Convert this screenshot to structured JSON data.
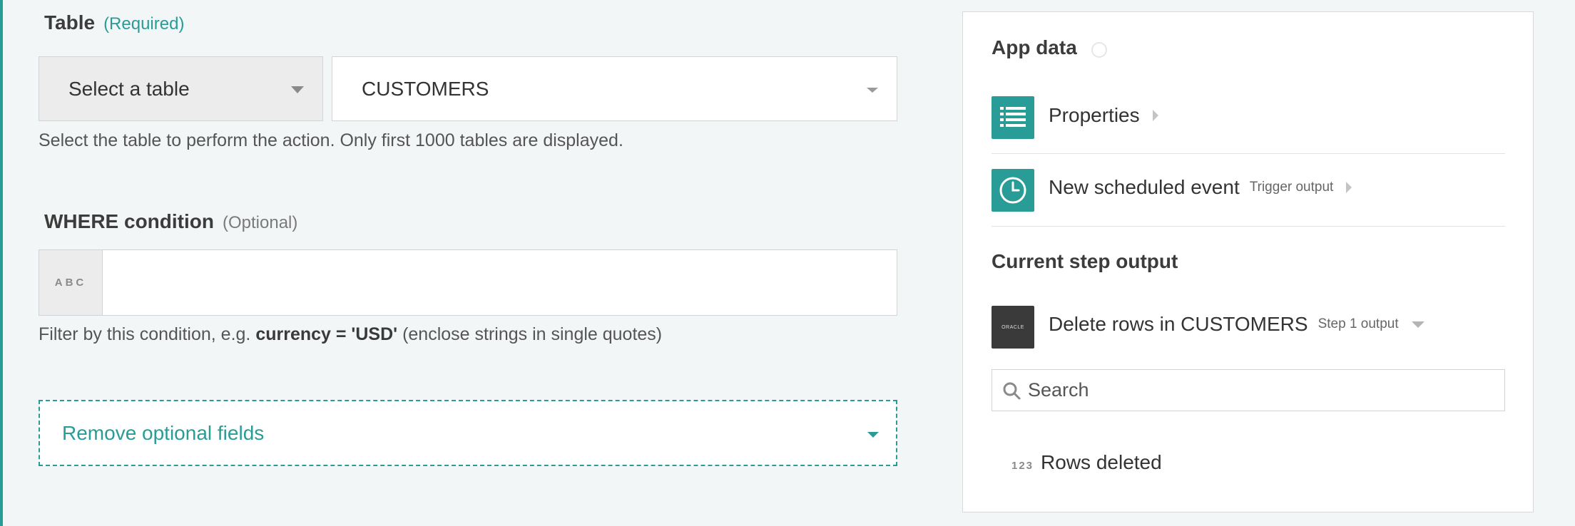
{
  "table_field": {
    "title": "Table",
    "qualifier": "(Required)",
    "mode_select": "Select a table",
    "value": "CUSTOMERS",
    "help": "Select the table to perform the action. Only first 1000 tables are displayed."
  },
  "where_field": {
    "title": "WHERE condition",
    "qualifier": "(Optional)",
    "type_badge": "ABC",
    "value": "",
    "help_prefix": "Filter by this condition, e.g.",
    "help_example": "currency = 'USD'",
    "help_suffix": "(enclose strings in single quotes)"
  },
  "remove_optional_label": "Remove optional fields",
  "app_data": {
    "heading": "App data",
    "items": [
      {
        "label": "Properties",
        "sub": "",
        "icon": "list-icon"
      },
      {
        "label": "New scheduled event",
        "sub": "Trigger output",
        "icon": "clock-icon"
      }
    ]
  },
  "current_step": {
    "heading": "Current step output",
    "label": "Delete rows in CUSTOMERS",
    "sub": "Step 1 output",
    "logo_text": "ORACLE",
    "search_placeholder": "Search",
    "output_type": "123",
    "output_label": "Rows deleted"
  },
  "colors": {
    "accent": "#2a9c97",
    "tile_dark": "#3a3a3a"
  }
}
